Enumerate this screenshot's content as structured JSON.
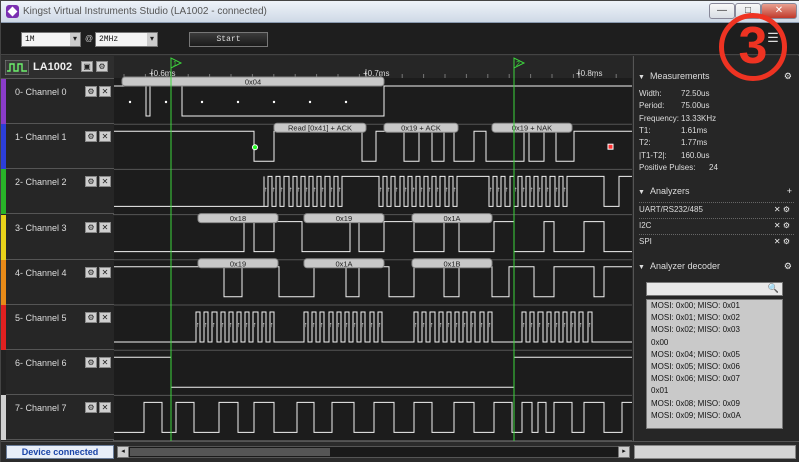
{
  "window": {
    "title": "Kingst Virtual Instruments Studio (LA1002 - connected)",
    "min_label": "—",
    "max_label": "□",
    "close_label": "✕"
  },
  "toolbar": {
    "samples": "1M",
    "rate_prefix": "@",
    "rate": "2MHz",
    "start_label": "Start"
  },
  "overlay_number": "3",
  "device": {
    "name": "LA1002"
  },
  "timeline": {
    "ticks": [
      "+0.6ms",
      "+0.7ms",
      "+0.8ms"
    ],
    "cursor1": "1",
    "cursor2": "2"
  },
  "channels": [
    {
      "label": "0-  Channel 0",
      "color": "#8a3cc8"
    },
    {
      "label": "1-  Channel 1",
      "color": "#2c3ed8"
    },
    {
      "label": "2-  Channel 2",
      "color": "#28b428"
    },
    {
      "label": "3-  Channel 3",
      "color": "#e8d21a"
    },
    {
      "label": "4-  Channel 4",
      "color": "#e88a18"
    },
    {
      "label": "5-  Channel 5",
      "color": "#e02020"
    },
    {
      "label": "6-  Channel 6",
      "color": "#222222"
    },
    {
      "label": "7-  Channel 7",
      "color": "#d0d0d0"
    }
  ],
  "decode_labels": {
    "ch0": "0x04",
    "ch1": [
      "Read [0x41] + ACK",
      "0x19 + ACK",
      "0x19 + NAK"
    ],
    "ch3": [
      "0x18",
      "0x19",
      "0x1A"
    ],
    "ch4": [
      "0x19",
      "0x1A",
      "0x1B"
    ]
  },
  "measurements": {
    "title": "Measurements",
    "rows": [
      {
        "k": "Width:",
        "v": "72.50us"
      },
      {
        "k": "Period:",
        "v": "75.00us"
      },
      {
        "k": "Frequency:",
        "v": "13.33KHz"
      },
      {
        "k": "T1:",
        "v": "1.61ms"
      },
      {
        "k": "T2:",
        "v": "1.77ms"
      },
      {
        "k": "|T1-T2|:",
        "v": "160.0us"
      },
      {
        "k": "Positive Pulses:",
        "v": "24"
      }
    ]
  },
  "analyzers": {
    "title": "Analyzers",
    "items": [
      "UART/RS232/485",
      "I2C",
      "SPI"
    ]
  },
  "decoder": {
    "title": "Analyzer decoder",
    "items": [
      "MOSI: 0x00;  MISO: 0x01",
      "MOSI: 0x01;  MISO: 0x02",
      "MOSI: 0x02;  MISO: 0x03",
      "0x00",
      "MOSI: 0x04;  MISO: 0x05",
      "MOSI: 0x05;  MISO: 0x06",
      "MOSI: 0x06;  MISO: 0x07",
      "0x01",
      "MOSI: 0x08;  MISO: 0x09",
      "MOSI: 0x09;  MISO: 0x0A"
    ]
  },
  "status": {
    "device": "Device connected"
  }
}
